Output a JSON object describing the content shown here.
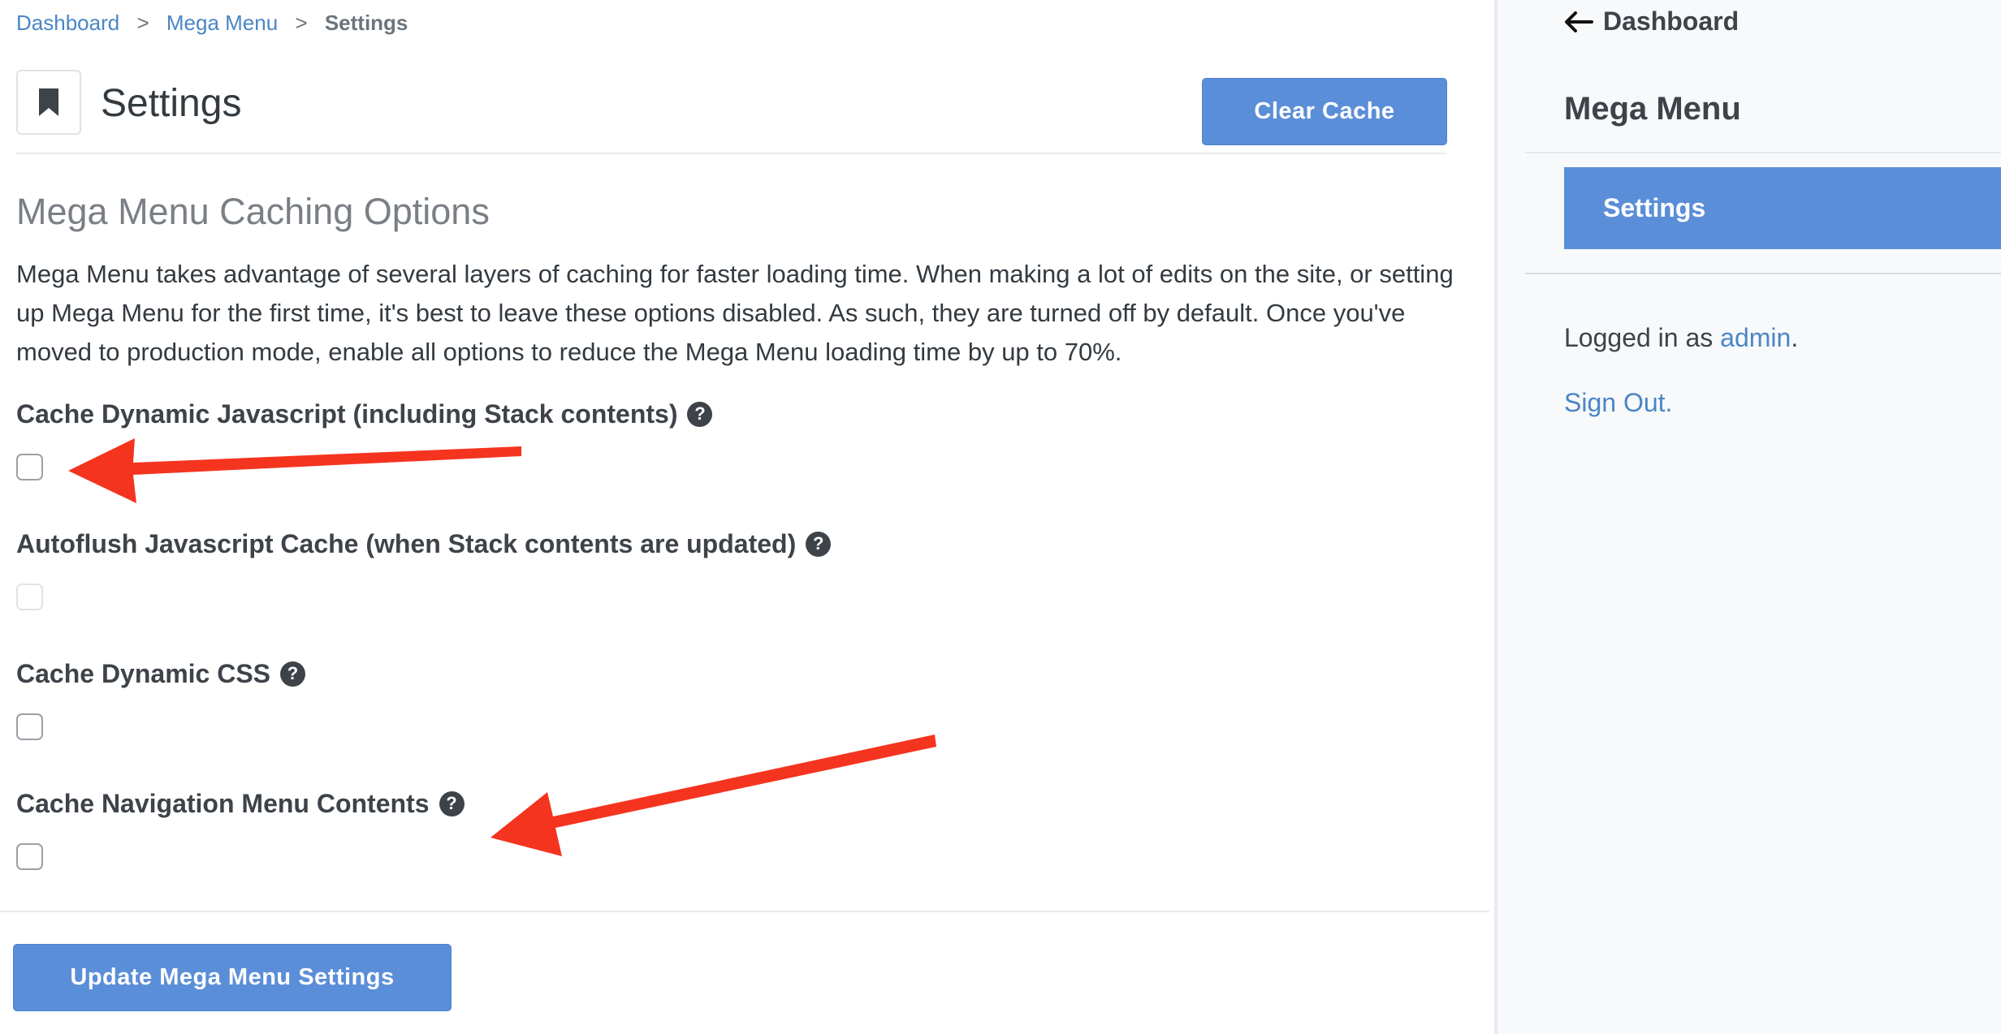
{
  "breadcrumb": {
    "items": [
      "Dashboard",
      "Mega Menu"
    ],
    "separator": ">",
    "current": "Settings"
  },
  "header": {
    "title": "Settings",
    "clear_cache_label": "Clear Cache"
  },
  "section": {
    "title": "Mega Menu Caching Options",
    "description": "Mega Menu takes advantage of several layers of caching for faster loading time. When making a lot of edits on the site, or setting up Mega Menu for the first time, it's best to leave these options disabled. As such, they are turned off by default. Once you've moved to production mode, enable all options to reduce the Mega Menu loading time by up to 70%."
  },
  "options": [
    {
      "label": "Cache Dynamic Javascript (including Stack contents)",
      "checked": false,
      "disabled": false
    },
    {
      "label": "Autoflush Javascript Cache (when Stack contents are updated)",
      "checked": false,
      "disabled": true
    },
    {
      "label": "Cache Dynamic CSS",
      "checked": false,
      "disabled": false
    },
    {
      "label": "Cache Navigation Menu Contents",
      "checked": false,
      "disabled": false
    }
  ],
  "help_glyph": "?",
  "footer": {
    "update_label": "Update Mega Menu Settings"
  },
  "sidebar": {
    "back_label": "Dashboard",
    "title": "Mega Menu",
    "active_item": "Settings",
    "logged_in_prefix": "Logged in as ",
    "username": "admin",
    "logged_in_suffix": ".",
    "sign_out": "Sign Out."
  },
  "colors": {
    "accent": "#5b8ed8",
    "link": "#4a86c5",
    "annotation_arrow": "#f5341f"
  }
}
